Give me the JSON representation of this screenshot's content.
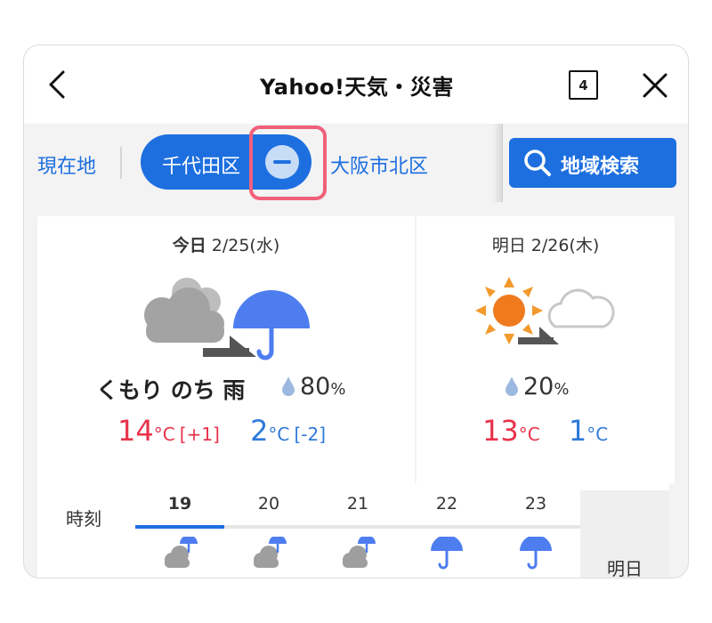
{
  "header": {
    "title": "Yahoo!天気・災害",
    "tab_count": "4"
  },
  "locations": {
    "current_label": "現在地",
    "selected_label": "千代田区",
    "other_label": "大阪市北区",
    "search_label": "地域検索"
  },
  "today": {
    "day_label": "今日",
    "date": "2/25(水)",
    "condition": "くもり のち 雨",
    "rain_value": "80",
    "rain_unit": "%",
    "high": "14",
    "high_unit": "°C",
    "high_diff": "[+1]",
    "low": "2",
    "low_unit": "°C",
    "low_diff": "[-2]"
  },
  "tomorrow": {
    "day_label": "明日",
    "date": "2/26(木)",
    "rain_value": "20",
    "rain_unit": "%",
    "high": "13",
    "high_unit": "°C",
    "low": "1",
    "low_unit": "°C"
  },
  "hourly": {
    "label": "時刻",
    "hours": [
      {
        "hour": "19",
        "icon": "cloud-rain-icon"
      },
      {
        "hour": "20",
        "icon": "cloud-rain-icon"
      },
      {
        "hour": "21",
        "icon": "cloud-rain-icon"
      },
      {
        "hour": "22",
        "icon": "umbrella-icon"
      },
      {
        "hour": "23",
        "icon": "umbrella-icon"
      }
    ],
    "tomorrow_tab": "明日"
  },
  "colors": {
    "accent": "#1d6fe0",
    "high_temp": "#e8334b",
    "low_temp": "#2f7ad9",
    "highlight": "#f0607a"
  }
}
